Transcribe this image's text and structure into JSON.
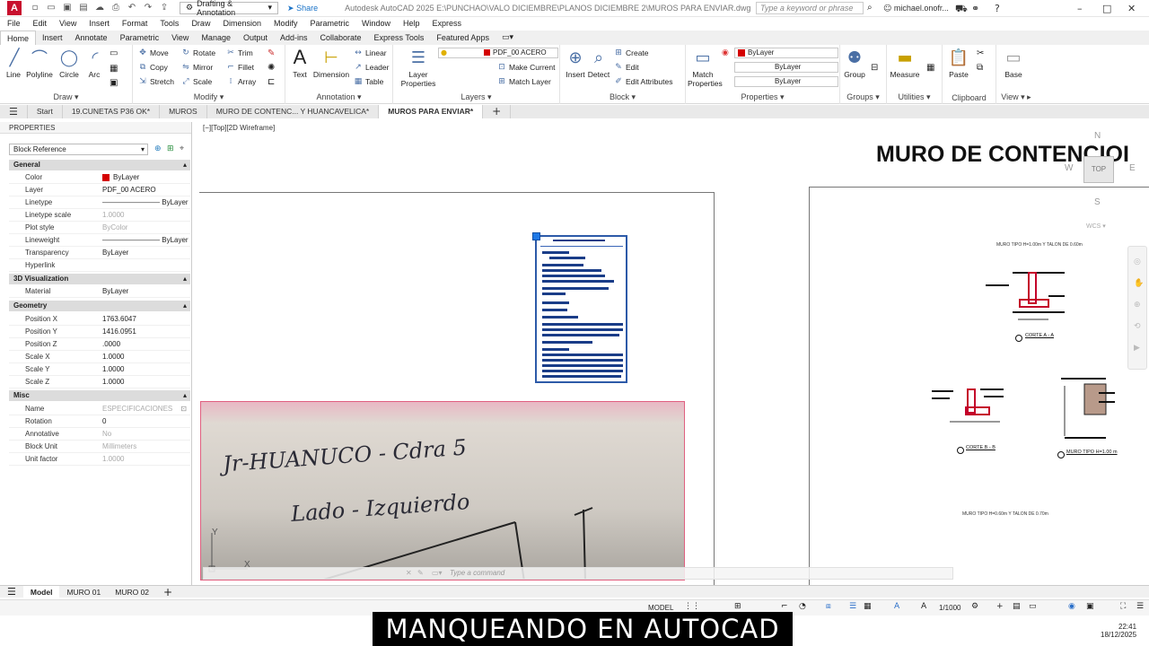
{
  "titlebar": {
    "app_logo": "A",
    "workspace": "Drafting & Annotation",
    "share": "Share",
    "title": "Autodesk AutoCAD 2025   E:\\PUNCHAO\\VALO DICIEMBRE\\PLANOS DICIEMBRE 2\\MUROS PARA ENVIAR.dwg",
    "search_placeholder": "Type a keyword or phrase",
    "user": "michael.onofr..."
  },
  "menu": [
    "File",
    "Edit",
    "View",
    "Insert",
    "Format",
    "Tools",
    "Draw",
    "Dimension",
    "Modify",
    "Parametric",
    "Window",
    "Help",
    "Express"
  ],
  "ribbon_tabs": [
    "Home",
    "Insert",
    "Annotate",
    "Parametric",
    "View",
    "Manage",
    "Output",
    "Add-ins",
    "Collaborate",
    "Express Tools",
    "Featured Apps"
  ],
  "ribbon": {
    "draw": {
      "title": "Draw",
      "line": "Line",
      "polyline": "Polyline",
      "circle": "Circle",
      "arc": "Arc"
    },
    "modify": {
      "title": "Modify",
      "move": "Move",
      "rotate": "Rotate",
      "trim": "Trim",
      "copy": "Copy",
      "mirror": "Mirror",
      "fillet": "Fillet",
      "stretch": "Stretch",
      "scale": "Scale",
      "array": "Array"
    },
    "annotation": {
      "title": "Annotation",
      "text": "Text",
      "dimension": "Dimension",
      "linear": "Linear",
      "leader": "Leader",
      "table": "Table"
    },
    "layers": {
      "title": "Layers",
      "layer_properties": "Layer Properties",
      "current_layer": "PDF_00 ACERO",
      "make_current": "Make Current",
      "match_layer": "Match Layer"
    },
    "block": {
      "title": "Block",
      "insert": "Insert",
      "detect": "Detect",
      "create": "Create",
      "edit": "Edit",
      "edit_attributes": "Edit Attributes"
    },
    "properties": {
      "title": "Properties",
      "match": "Match Properties",
      "color": "ByLayer",
      "linetype": "ByLayer",
      "lineweight": "ByLayer"
    },
    "groups": {
      "title": "Groups",
      "group": "Group"
    },
    "utilities": {
      "title": "Utilities",
      "measure": "Measure"
    },
    "clipboard": {
      "title": "Clipboard",
      "paste": "Paste"
    },
    "view": {
      "title": "View",
      "base": "Base"
    }
  },
  "doc_tabs": [
    "Start",
    "19.CUNETAS P36 OK*",
    "MUROS",
    "MURO DE CONTENC... Y HUANCAVELICA*",
    "MUROS PARA ENVIAR*"
  ],
  "properties": {
    "header": "PROPERTIES",
    "selection": "Block Reference",
    "general": {
      "title": "General",
      "color": "ByLayer",
      "layer": "PDF_00 ACERO",
      "linetype": "ByLayer",
      "linetype_scale": "1.0000",
      "plot_style": "ByColor",
      "lineweight": "ByLayer",
      "transparency": "ByLayer",
      "hyperlink": ""
    },
    "viz": {
      "title": "3D Visualization",
      "material": "ByLayer"
    },
    "geometry": {
      "title": "Geometry",
      "pos_x": "1763.6047",
      "pos_y": "1416.0951",
      "pos_z": ".0000",
      "scale_x": "1.0000",
      "scale_y": "1.0000",
      "scale_z": "1.0000"
    },
    "misc": {
      "title": "Misc",
      "name": "ESPECIFICACIONES",
      "rotation": "0",
      "annotative": "No",
      "block_unit": "Millimeters",
      "unit_factor": "1.0000"
    },
    "labels": {
      "color": "Color",
      "layer": "Layer",
      "linetype": "Linetype",
      "linetype_scale": "Linetype scale",
      "plot_style": "Plot style",
      "lineweight": "Lineweight",
      "transparency": "Transparency",
      "hyperlink": "Hyperlink",
      "material": "Material",
      "pos_x": "Position X",
      "pos_y": "Position Y",
      "pos_z": "Position Z",
      "scale_x": "Scale X",
      "scale_y": "Scale Y",
      "scale_z": "Scale Z",
      "name": "Name",
      "rotation": "Rotation",
      "annotative": "Annotative",
      "block_unit": "Block Unit",
      "unit_factor": "Unit factor"
    }
  },
  "canvas": {
    "view_label": "[−][Top][2D Wireframe]",
    "title": "MURO DE CONTENCIOI",
    "handwriting_line1": "Jr-HUANUCO - Cdra 5",
    "handwriting_line2": "Lado - Izquierdo",
    "section_a": "CORTE A - A",
    "section_b": "CORTE B - B",
    "wall_caption_top": "MURO TIPO H=1.00m Y TALON DE 0.60m",
    "wall_caption_mid": "MURO TIPO H=1.00 m",
    "wall_caption_bottom": "MURO TIPO H=0.60m Y TALON DE 0.70m",
    "compass_n": "N",
    "compass_e": "E",
    "compass_s": "S",
    "compass_w": "W",
    "compass_top": "TOP",
    "wcs": "WCS",
    "ucs_x": "X",
    "ucs_y": "Y"
  },
  "command": {
    "placeholder": "Type a command"
  },
  "layout_tabs": [
    "Model",
    "MURO 01",
    "MURO 02"
  ],
  "status": {
    "model": "MODEL",
    "scale": "1/1000"
  },
  "overlay_caption": "MANQUEANDO EN AUTOCAD",
  "clock": {
    "time": "22:41",
    "date": "18/12/2025"
  }
}
